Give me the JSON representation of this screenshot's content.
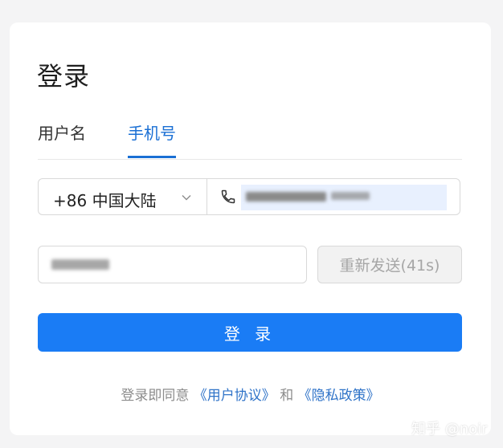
{
  "page": {
    "title": "登录"
  },
  "tabs": [
    {
      "label": "用户名",
      "active": false
    },
    {
      "label": "手机号",
      "active": true
    }
  ],
  "phone": {
    "region_label": "+86 中国大陆",
    "value": "",
    "phone_icon": "phone-icon",
    "chevron_icon": "chevron-down-icon"
  },
  "code": {
    "value": ""
  },
  "buttons": {
    "resend_label": "重新发送(41s)",
    "login_label": "登 录"
  },
  "agreement": {
    "prefix": "登录即同意",
    "user_agreement": "《用户协议》",
    "conjunction": "和",
    "privacy_policy": "《隐私政策》"
  },
  "watermark": {
    "text": "知乎 @noir"
  },
  "colors": {
    "accent": "#1a7cf5",
    "tab_active": "#1a6fd4",
    "link": "#2f73c8",
    "input_fill": "#e8f0fe"
  }
}
